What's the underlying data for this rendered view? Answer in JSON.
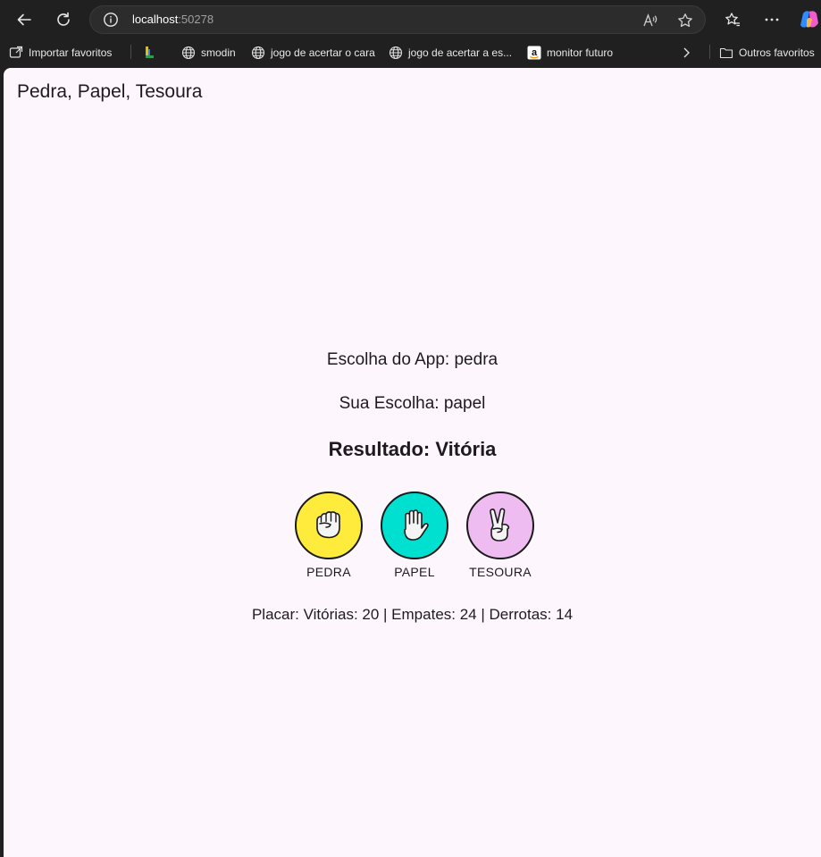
{
  "browser": {
    "url_host": "localhost",
    "url_port": ":50278",
    "bookmarks": [
      {
        "label": "Importar favoritos",
        "icon": "import-icon"
      },
      {
        "label": "",
        "icon": "green-app-icon"
      },
      {
        "label": "smodin",
        "icon": "globe-icon"
      },
      {
        "label": "jogo de acertar o cara",
        "icon": "globe-icon"
      },
      {
        "label": "jogo de acertar a es...",
        "icon": "globe-icon"
      },
      {
        "label": "monitor futuro",
        "icon": "amazon-icon"
      }
    ],
    "other_favorites": "Outros favoritos"
  },
  "app": {
    "title": "Pedra, Papel, Tesoura",
    "app_choice": "Escolha do App: pedra",
    "user_choice": "Sua Escolha: papel",
    "result": "Resultado: Vitória",
    "choices": [
      {
        "label": "PEDRA",
        "color": "#ffeb3b",
        "icon": "fist-icon"
      },
      {
        "label": "PAPEL",
        "color": "#00e0d0",
        "icon": "open-hand-icon"
      },
      {
        "label": "TESOURA",
        "color": "#eebcf0",
        "icon": "victory-hand-icon"
      }
    ],
    "score": "Placar: Vitórias: 20 | Empates: 24 | Derrotas: 14"
  }
}
